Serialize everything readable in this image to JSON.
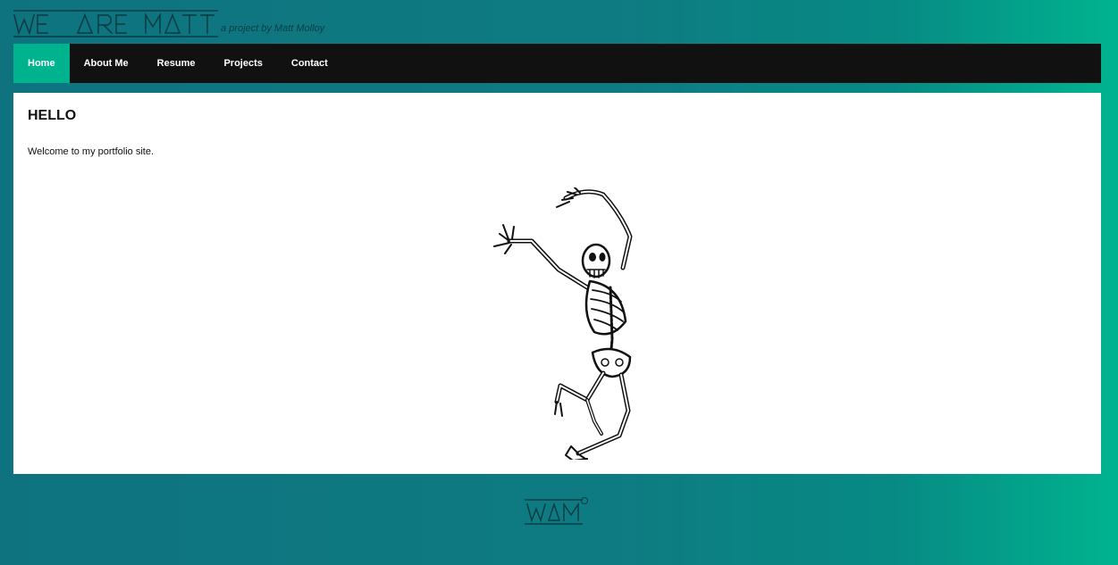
{
  "header": {
    "logo_text": "WE ARE MATT",
    "tagline": "a project by Matt Molloy"
  },
  "nav": {
    "items": [
      {
        "label": "Home",
        "active": true
      },
      {
        "label": "About Me",
        "active": false
      },
      {
        "label": "Resume",
        "active": false
      },
      {
        "label": "Projects",
        "active": false
      },
      {
        "label": "Contact",
        "active": false
      }
    ]
  },
  "main": {
    "heading": "HELLO",
    "welcome": "Welcome to my portfolio site.",
    "image": "dancing-skeleton-illustration"
  },
  "footer": {
    "logo_text": "WAM",
    "copyright_symbol": "©"
  },
  "colors": {
    "accent": "#00b38f",
    "nav_bg": "#111111",
    "logo_ink": "#0b3d44"
  }
}
